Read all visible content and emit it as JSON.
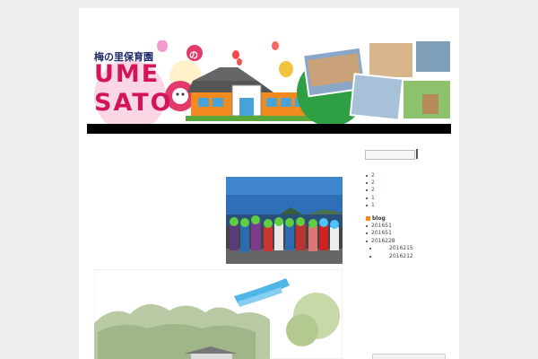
{
  "header": {
    "subtitle": "梅の里保育園",
    "logo_line1": "UME",
    "logo_line2": "SATO",
    "logo_badge": "の"
  },
  "sidebar": {
    "archive_items": [
      "2",
      "2",
      "2",
      "1",
      "1"
    ],
    "blog_heading": "blog",
    "blog_items": [
      {
        "label": "201651",
        "sub": false
      },
      {
        "label": "201651",
        "sub": false
      },
      {
        "label": "2016228",
        "sub": false
      },
      {
        "label": "2016215",
        "sub": true
      },
      {
        "label": "2016212",
        "sub": true
      }
    ]
  },
  "colors": {
    "accent": "#d4145a",
    "navy": "#1e2a6a",
    "link": "#44558f",
    "rss": "#f28a1e"
  }
}
